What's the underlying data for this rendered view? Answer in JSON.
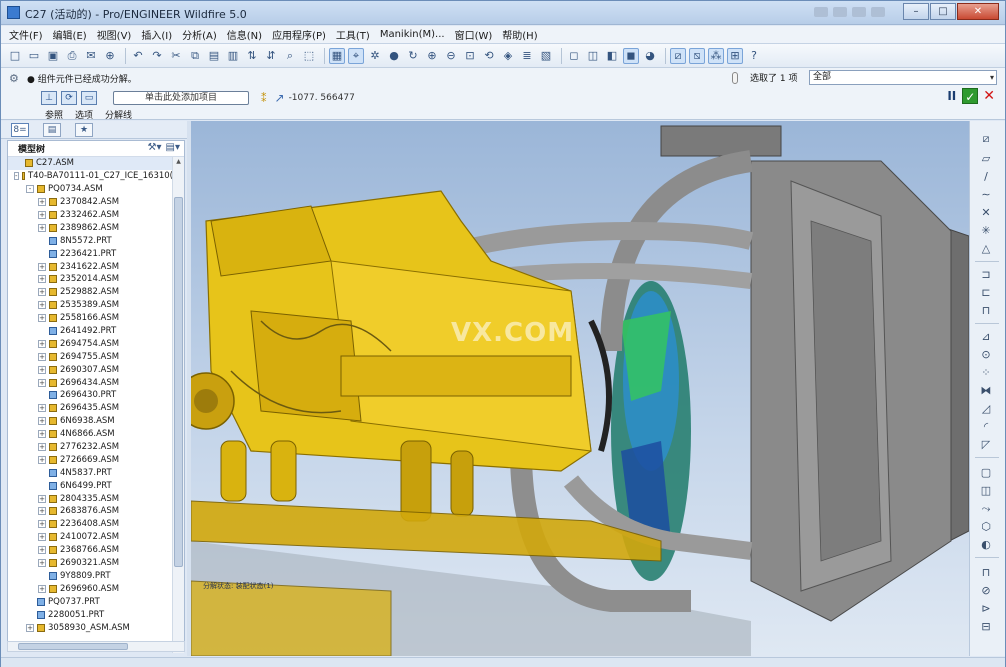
{
  "window": {
    "title": "C27 (活动的) - Pro/ENGINEER Wildfire 5.0",
    "buttons": [
      "–",
      "□",
      "✕"
    ]
  },
  "menu": [
    "文件(F)",
    "编辑(E)",
    "视图(V)",
    "插入(I)",
    "分析(A)",
    "信息(N)",
    "应用程序(P)",
    "工具(T)",
    "Manikin(M)...",
    "窗口(W)",
    "帮助(H)"
  ],
  "message": "● 组件元件已经成功分解。",
  "selection": {
    "count_text": "选取了 1 项",
    "filter": "全部"
  },
  "dashboard": {
    "collector_placeholder": "单击此处添加项目",
    "vector_value": "-1077. 566477",
    "tabs": [
      "参照",
      "选项",
      "分解线"
    ]
  },
  "model_tree": {
    "title": "模型树",
    "items": [
      {
        "label": "C27.ASM",
        "level": 0,
        "type": "asm",
        "exp": "none"
      },
      {
        "label": "T40-BA70111-01_C27_ICE_16310(",
        "level": 0,
        "type": "asm",
        "exp": "-"
      },
      {
        "label": "PQ0734.ASM",
        "level": 1,
        "type": "asm",
        "exp": "-"
      },
      {
        "label": "2370842.ASM",
        "level": 2,
        "type": "asm",
        "exp": "+"
      },
      {
        "label": "2332462.ASM",
        "level": 2,
        "type": "asm",
        "exp": "+"
      },
      {
        "label": "2389862.ASM",
        "level": 2,
        "type": "asm",
        "exp": "+"
      },
      {
        "label": "8N5572.PRT",
        "level": 2,
        "type": "prt",
        "exp": "none"
      },
      {
        "label": "2236421.PRT",
        "level": 2,
        "type": "prt",
        "exp": "none"
      },
      {
        "label": "2341622.ASM",
        "level": 2,
        "type": "asm",
        "exp": "+"
      },
      {
        "label": "2352014.ASM",
        "level": 2,
        "type": "asm",
        "exp": "+"
      },
      {
        "label": "2529882.ASM",
        "level": 2,
        "type": "asm",
        "exp": "+"
      },
      {
        "label": "2535389.ASM",
        "level": 2,
        "type": "asm",
        "exp": "+"
      },
      {
        "label": "2558166.ASM",
        "level": 2,
        "type": "asm",
        "exp": "+"
      },
      {
        "label": "2641492.PRT",
        "level": 2,
        "type": "prt",
        "exp": "none"
      },
      {
        "label": "2694754.ASM",
        "level": 2,
        "type": "asm",
        "exp": "+"
      },
      {
        "label": "2694755.ASM",
        "level": 2,
        "type": "asm",
        "exp": "+"
      },
      {
        "label": "2690307.ASM",
        "level": 2,
        "type": "asm",
        "exp": "+"
      },
      {
        "label": "2696434.ASM",
        "level": 2,
        "type": "asm",
        "exp": "+"
      },
      {
        "label": "2696430.PRT",
        "level": 2,
        "type": "prt",
        "exp": "none"
      },
      {
        "label": "2696435.ASM",
        "level": 2,
        "type": "asm",
        "exp": "+"
      },
      {
        "label": "6N6938.ASM",
        "level": 2,
        "type": "asm",
        "exp": "+"
      },
      {
        "label": "4N6866.ASM",
        "level": 2,
        "type": "asm",
        "exp": "+"
      },
      {
        "label": "2776232.ASM",
        "level": 2,
        "type": "asm",
        "exp": "+"
      },
      {
        "label": "2726669.ASM",
        "level": 2,
        "type": "asm",
        "exp": "+"
      },
      {
        "label": "4N5837.PRT",
        "level": 2,
        "type": "prt",
        "exp": "none"
      },
      {
        "label": "6N6499.PRT",
        "level": 2,
        "type": "prt",
        "exp": "none"
      },
      {
        "label": "2804335.ASM",
        "level": 2,
        "type": "asm",
        "exp": "+"
      },
      {
        "label": "2683876.ASM",
        "level": 2,
        "type": "asm",
        "exp": "+"
      },
      {
        "label": "2236408.ASM",
        "level": 2,
        "type": "asm",
        "exp": "+"
      },
      {
        "label": "2410072.ASM",
        "level": 2,
        "type": "asm",
        "exp": "+"
      },
      {
        "label": "2368766.ASM",
        "level": 2,
        "type": "asm",
        "exp": "+"
      },
      {
        "label": "2690321.ASM",
        "level": 2,
        "type": "asm",
        "exp": "+"
      },
      {
        "label": "9Y8809.PRT",
        "level": 2,
        "type": "prt",
        "exp": "none"
      },
      {
        "label": "2696960.ASM",
        "level": 2,
        "type": "asm",
        "exp": "+"
      },
      {
        "label": "PQ0737.PRT",
        "level": 1,
        "type": "prt",
        "exp": "none"
      },
      {
        "label": "2280051.PRT",
        "level": 1,
        "type": "prt",
        "exp": "none"
      },
      {
        "label": "3058930_ASM.ASM",
        "level": 1,
        "type": "asm",
        "exp": "+"
      }
    ]
  },
  "viewport": {
    "watermark": "VX.COM",
    "status": "分解状态: 装配状态(1)"
  }
}
